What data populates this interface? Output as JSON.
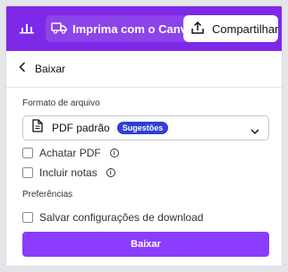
{
  "topbar": {
    "print_label": "Imprima com o Canva",
    "share_label": "Compartilhar",
    "background_color": "#7d2ae8",
    "icons": [
      "chart-bars-icon",
      "truck-icon",
      "share-upload-icon"
    ]
  },
  "panel": {
    "back_label": "Baixar",
    "file_format_label": "Formato de arquivo",
    "selected_format": "PDF padrão",
    "suggested_badge": "Sugestões",
    "flatten_pdf_label": "Achatar PDF",
    "include_notes_label": "Incluir notas",
    "preferences_label": "Preferências",
    "save_settings_label": "Salvar configurações de download",
    "download_button_label": "Baixar",
    "flatten_pdf_checked": false,
    "include_notes_checked": false,
    "save_settings_checked": false,
    "accent_color": "#8b3dff",
    "badge_color": "#2e3fd6"
  }
}
